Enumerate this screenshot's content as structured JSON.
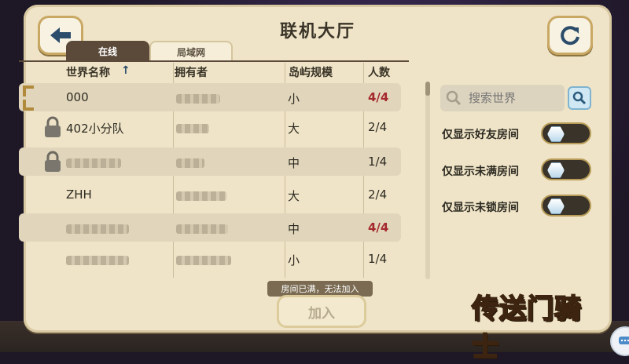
{
  "title": "联机大厅",
  "tabs": [
    {
      "label": "在线",
      "active": true
    },
    {
      "label": "局域网",
      "active": false
    }
  ],
  "columns": {
    "world_name": "世界名称",
    "sort_arrow": "↑",
    "owner": "拥有者",
    "island_size": "岛屿规模",
    "players": "人数"
  },
  "rows": [
    {
      "name": "000",
      "owner_blurred": true,
      "size": "小",
      "players": "4/4",
      "full": true,
      "locked": false
    },
    {
      "name": "402小分队",
      "owner_blurred": true,
      "size": "大",
      "players": "2/4",
      "full": false,
      "locked": true
    },
    {
      "name": "",
      "name_blurred": true,
      "owner_blurred": true,
      "size": "中",
      "players": "1/4",
      "full": false,
      "locked": true
    },
    {
      "name": "ZHH",
      "owner_blurred": true,
      "size": "大",
      "players": "2/4",
      "full": false,
      "locked": false
    },
    {
      "name": "",
      "name_blurred": true,
      "owner_blurred": true,
      "size": "中",
      "players": "4/4",
      "full": true,
      "locked": false
    },
    {
      "name": "",
      "name_blurred": true,
      "owner_blurred": true,
      "size": "小",
      "players": "1/4",
      "full": false,
      "locked": false
    }
  ],
  "search": {
    "placeholder": "搜索世界",
    "value": ""
  },
  "filters": [
    {
      "label": "仅显示好友房间",
      "on": false
    },
    {
      "label": "仅显示未满房间",
      "on": false
    },
    {
      "label": "仅显示未锁房间",
      "on": false
    }
  ],
  "hint": "房间已满，无法加入",
  "join_label": "加入",
  "logo_text": "传送门骑士",
  "colors": {
    "full_red": "#a5282d",
    "tab_active": "#5b4a3a",
    "panel": "#efe4c7"
  },
  "icons": {
    "back": "back-arrow-icon",
    "refresh": "refresh-icon",
    "search": "search-icon",
    "lock": "lock-icon",
    "chat": "chat-icon"
  }
}
